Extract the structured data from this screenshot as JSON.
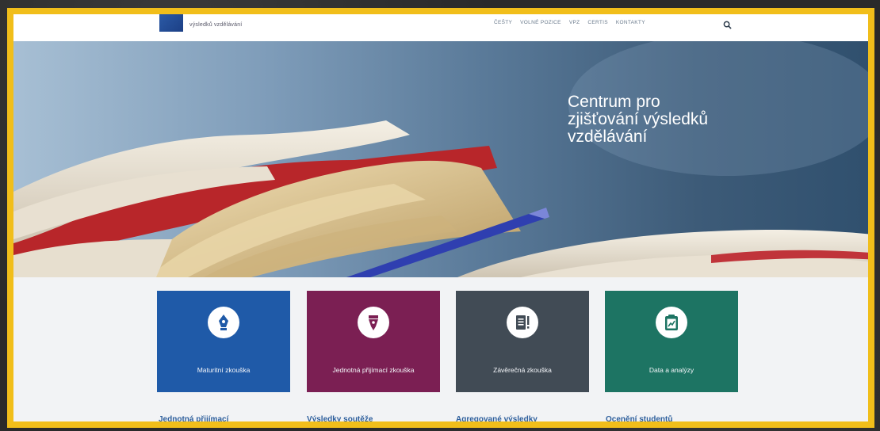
{
  "header": {
    "logo_text": "výsledků vzdělávání",
    "nav": [
      "ČEŠTY",
      "VOLNÉ POZICE",
      "VPZ",
      "CERTIS",
      "KONTAKTY"
    ]
  },
  "hero": {
    "title": "Centrum pro\nzjišťování výsledků\nvzdělávání"
  },
  "tiles": [
    {
      "label": "Maturitní zkouška",
      "icon": "fountain-pen-nib-icon",
      "color": "#1f5aa8"
    },
    {
      "label": "Jednotná přijímací zkouška",
      "icon": "fountain-pen-icon",
      "color": "#7b1f53"
    },
    {
      "label": "Závěrečná zkouška",
      "icon": "document-exclamation-icon",
      "color": "#414b55"
    },
    {
      "label": "Data a analýzy",
      "icon": "clipboard-chart-icon",
      "color": "#1d7463"
    }
  ],
  "bottom_headings": [
    "Jednotná přijímací",
    "Výsledky soutěže",
    "Agregované výsledky",
    "Ocenění studentů"
  ]
}
